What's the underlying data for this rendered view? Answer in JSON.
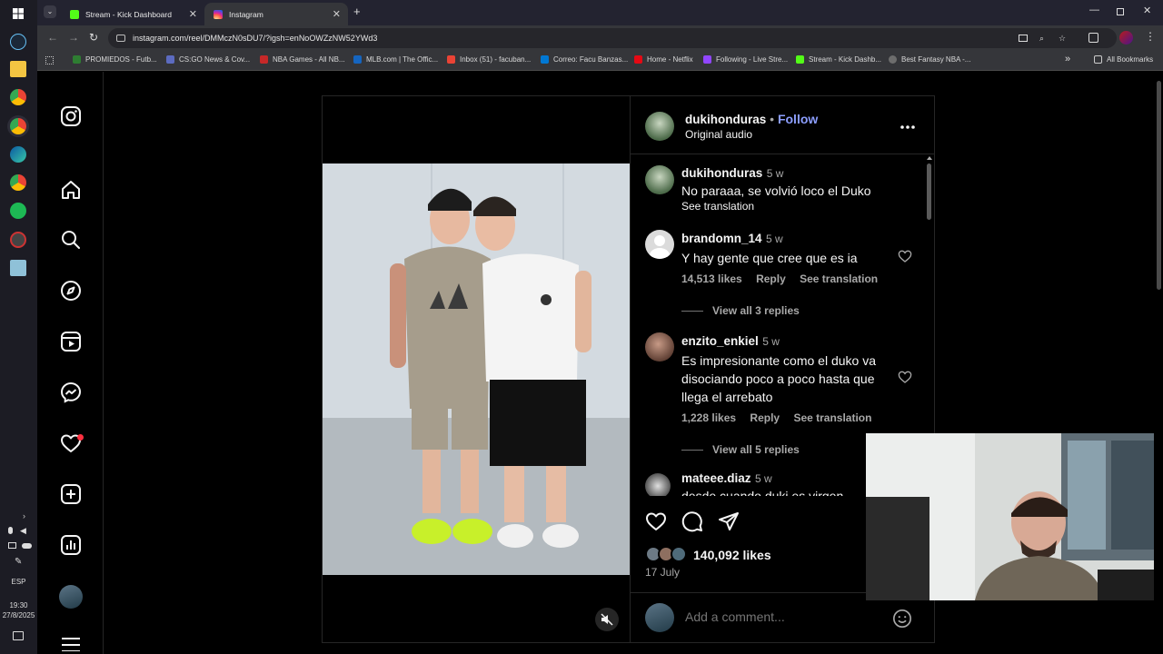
{
  "taskbar": {
    "clock_time": "19:30",
    "clock_date": "27/8/2025",
    "language": "ESP"
  },
  "tabs": [
    {
      "title": "Stream - Kick Dashboard",
      "icon": "kick-icon",
      "color": "#53fc18"
    },
    {
      "title": "Instagram",
      "icon": "instagram-icon",
      "color": "#e1306c"
    }
  ],
  "address_bar": {
    "url": "instagram.com/reel/DMMczN0sDU7/?igsh=enNoOWZzNW52YWd3"
  },
  "bookmarks": [
    {
      "label": "PROMIEDOS - Futb...",
      "color": "#2e7d32"
    },
    {
      "label": "CS:GO News & Cov...",
      "color": "#5c6bc0"
    },
    {
      "label": "NBA Games - All NB...",
      "color": "#c62828"
    },
    {
      "label": "MLB.com | The Offic...",
      "color": "#1565c0"
    },
    {
      "label": "Inbox (51) - facuban...",
      "color": "#ea4335"
    },
    {
      "label": "Correo: Facu Banzas...",
      "color": "#0078d4"
    },
    {
      "label": "Home - Netflix",
      "color": "#e50914"
    },
    {
      "label": "Following - Live Stre...",
      "color": "#9146ff"
    },
    {
      "label": "Stream - Kick Dashb...",
      "color": "#53fc18"
    },
    {
      "label": "Best Fantasy NBA -...",
      "color": "#6d6d6d"
    }
  ],
  "bookmarks_all": "All Bookmarks",
  "post": {
    "author": "dukihonduras",
    "follow_separator": "•",
    "follow_label": "Follow",
    "audio": "Original audio",
    "caption": {
      "user": "dukihonduras",
      "ago": "5 w",
      "text": "No paraaa, se volvió loco el Duko",
      "translate": "See translation"
    },
    "comments": [
      {
        "user": "brandomn_14",
        "ago": "5 w",
        "text": "Y hay gente que cree que es ia",
        "likes": "14,513 likes",
        "reply": "Reply",
        "translate": "See translation",
        "view_replies": "View all 3 replies"
      },
      {
        "user": "enzito_enkiel",
        "ago": "5 w",
        "text": "Es impresionante como el duko va disociando poco a poco hasta que llega el arrebato",
        "likes": "1,228 likes",
        "reply": "Reply",
        "translate": "See translation",
        "view_replies": "View all 5 replies"
      },
      {
        "user": "mateee.diaz",
        "ago": "5 w",
        "text": "desde cuando duki es virgen"
      }
    ],
    "likes": "140,092 likes",
    "date": "17 July",
    "add_comment_placeholder": "Add a comment..."
  },
  "colors": {
    "accent_follow": "#8c9eff",
    "notification": "#ff3040"
  }
}
